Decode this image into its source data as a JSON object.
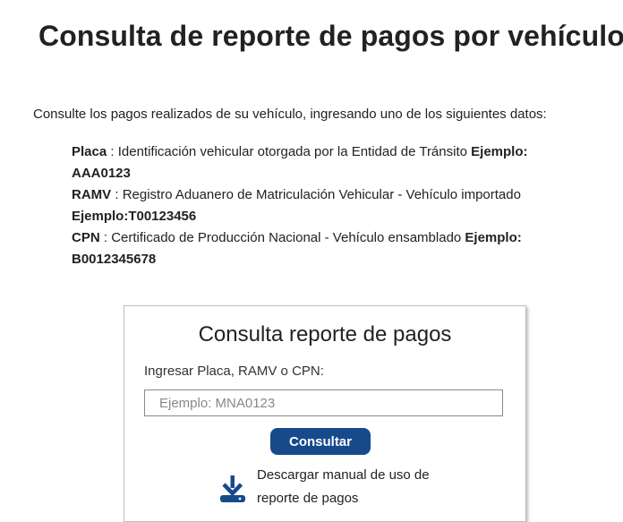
{
  "header": {
    "title": "Consulta de reporte de pagos por vehículo"
  },
  "intro": "Consulte los pagos realizados de su vehículo, ingresando uno de los siguientes datos:",
  "definitions": {
    "placa": {
      "term": "Placa",
      "sep": " : ",
      "desc": "Identificación vehicular otorgada por la Entidad de Tránsito ",
      "example_label": "Ejemplo:",
      "example_value": "AAA0123"
    },
    "ramv": {
      "term": "RAMV",
      "sep": " : ",
      "desc": "Registro Aduanero de Matriculación Vehicular - Vehículo importado",
      "example": "Ejemplo:T00123456"
    },
    "cpn": {
      "term": "CPN",
      "sep": " : ",
      "desc": "Certificado de Producción Nacional - Vehículo ensamblado ",
      "example_label": "Ejemplo:",
      "example_value": "B0012345678"
    }
  },
  "form": {
    "title": "Consulta reporte de pagos",
    "label": "Ingresar Placa, RAMV o CPN:",
    "input_value": "",
    "placeholder": "Ejemplo: MNA0123",
    "button_label": "Consultar",
    "manual_line1": "Descargar manual de uso de",
    "manual_line2": "reporte de pagos",
    "manual_icon": "download-icon"
  },
  "colors": {
    "accent": "#174a8b",
    "text": "#222222"
  }
}
